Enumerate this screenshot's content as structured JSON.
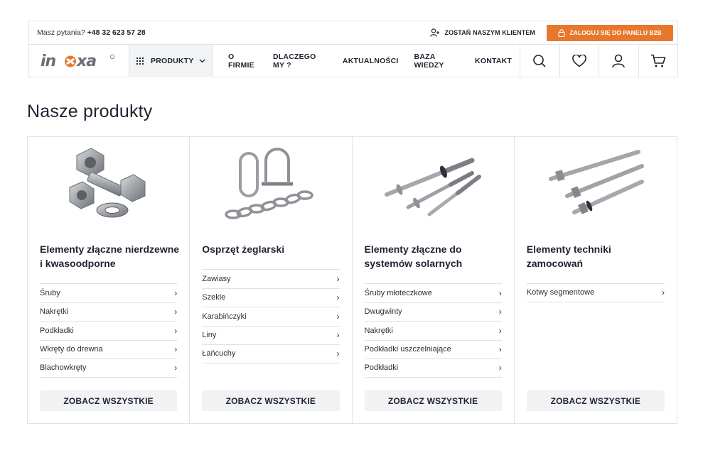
{
  "topbar": {
    "question_label": "Masz pytania?",
    "phone": "+48 32 623 57 28",
    "join_label": "ZOSTAŃ NASZYM KLIENTEM",
    "b2b_label": "ZALOGUJ SIĘ DO PANELU B2B"
  },
  "logo": {
    "text": "inoxa"
  },
  "nav": {
    "products_label": "PRODUKTY",
    "links": [
      "O FIRMIE",
      "DLACZEGO MY ?",
      "AKTUALNOŚCI",
      "BAZA WIEDZY",
      "KONTAKT"
    ],
    "icons": [
      "search-icon",
      "heart-icon",
      "user-icon",
      "cart-icon"
    ]
  },
  "page": {
    "title": "Nasze produkty"
  },
  "cards": [
    {
      "title": "Elementy złączne nierdzewne i kwasoodporne",
      "items": [
        "Śruby",
        "Nakrętki",
        "Podkładki",
        "Wkręty do drewna",
        "Blachowkręty"
      ],
      "button": "ZOBACZ WSZYSTKIE",
      "image": "bolts-nuts-image"
    },
    {
      "title": "Osprzęt żeglarski",
      "items": [
        "Zawiasy",
        "Szekle",
        "Karabińczyki",
        "Liny",
        "Łańcuchy"
      ],
      "button": "ZOBACZ WSZYSTKIE",
      "image": "shackle-chain-image"
    },
    {
      "title": "Elementy złączne do systemów solarnych",
      "items": [
        "Śruby młoteczkowe",
        "Dwugwinty",
        "Nakrętki",
        "Podkładki uszczelniające",
        "Podkładki"
      ],
      "button": "ZOBACZ WSZYSTKIE",
      "image": "solar-screws-image"
    },
    {
      "title": "Elementy techniki zamocowań",
      "items": [
        "Kotwy segmentowe"
      ],
      "button": "ZOBACZ WSZYSTKIE",
      "image": "anchor-bolts-image"
    }
  ],
  "colors": {
    "accent": "#e8772e",
    "text": "#1d2430",
    "border": "#e1e3e7",
    "button_bg": "#f1f2f4"
  }
}
